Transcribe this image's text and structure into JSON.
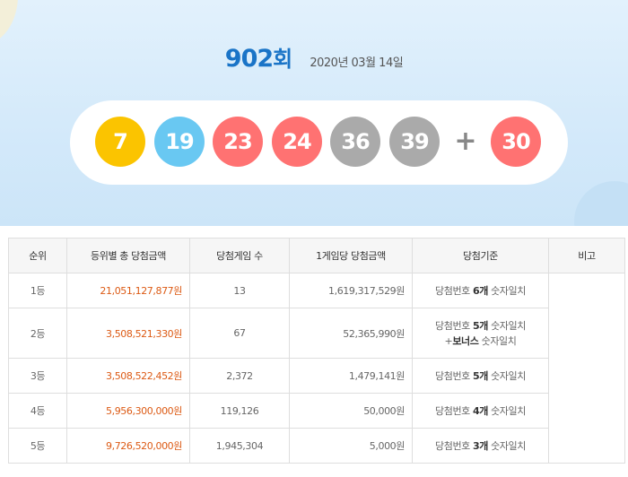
{
  "draw": {
    "round_number": "902",
    "round_suffix": "회",
    "date": "2020년 03월 14일"
  },
  "balls": [
    {
      "number": "7",
      "color": "yellow"
    },
    {
      "number": "19",
      "color": "blue"
    },
    {
      "number": "23",
      "color": "red"
    },
    {
      "number": "24",
      "color": "red"
    },
    {
      "number": "36",
      "color": "gray"
    },
    {
      "number": "39",
      "color": "gray"
    }
  ],
  "plus_sign": "+",
  "bonus_ball": {
    "number": "30",
    "color": "red"
  },
  "ball_colors": {
    "yellow": "#fbc400",
    "blue": "#69c8f2",
    "red": "#ff7272",
    "gray": "#aaaaaa"
  },
  "table": {
    "headers": [
      "순위",
      "등위별 총 당첨금액",
      "당첨게임 수",
      "1게임당 당첨금액",
      "당첨기준",
      "비고"
    ],
    "rows": [
      {
        "rank": "1등",
        "total": "21,051,127,877원",
        "winners": "13",
        "per_game": "1,619,317,529원",
        "criteria_pre": "당첨번호 ",
        "criteria_bold": "6개",
        "criteria_post": " 숫자일치",
        "criteria2_pre": "",
        "criteria2_bold": "",
        "criteria2_post": ""
      },
      {
        "rank": "2등",
        "total": "3,508,521,330원",
        "winners": "67",
        "per_game": "52,365,990원",
        "criteria_pre": "당첨번호 ",
        "criteria_bold": "5개",
        "criteria_post": " 숫자일치",
        "criteria2_pre": "+",
        "criteria2_bold": "보너스",
        "criteria2_post": " 숫자일치"
      },
      {
        "rank": "3등",
        "total": "3,508,522,452원",
        "winners": "2,372",
        "per_game": "1,479,141원",
        "criteria_pre": "당첨번호 ",
        "criteria_bold": "5개",
        "criteria_post": " 숫자일치",
        "criteria2_pre": "",
        "criteria2_bold": "",
        "criteria2_post": ""
      },
      {
        "rank": "4등",
        "total": "5,956,300,000원",
        "winners": "119,126",
        "per_game": "50,000원",
        "criteria_pre": "당첨번호 ",
        "criteria_bold": "4개",
        "criteria_post": " 숫자일치",
        "criteria2_pre": "",
        "criteria2_bold": "",
        "criteria2_post": ""
      },
      {
        "rank": "5등",
        "total": "9,726,520,000원",
        "winners": "1,945,304",
        "per_game": "5,000원",
        "criteria_pre": "당첨번호 ",
        "criteria_bold": "3개",
        "criteria_post": " 숫자일치",
        "criteria2_pre": "",
        "criteria2_bold": "",
        "criteria2_post": ""
      }
    ],
    "note": ""
  }
}
